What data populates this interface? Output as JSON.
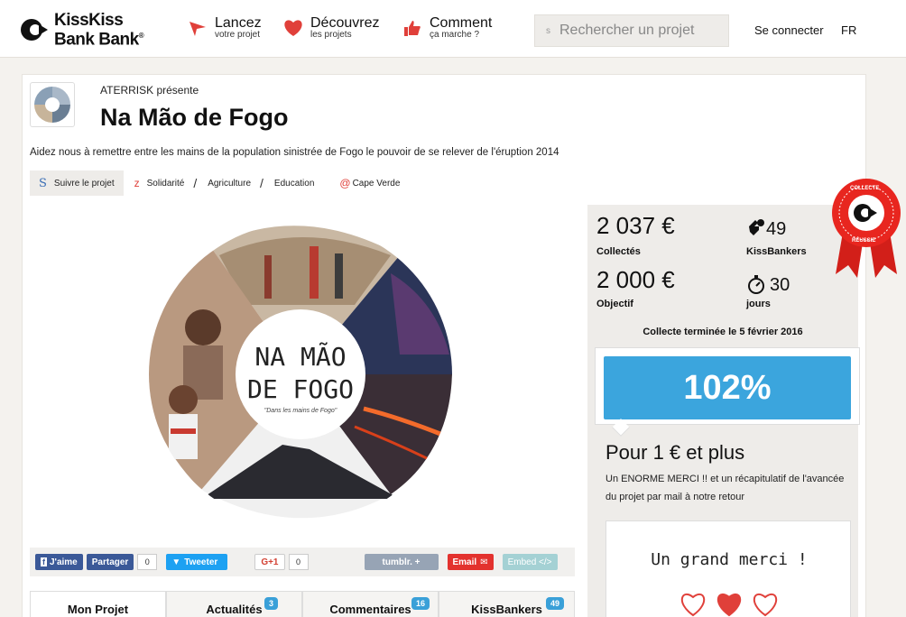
{
  "header": {
    "logo_text_line1": "KissKiss",
    "logo_text_line2": "Bank Bank",
    "logo_reg": "®",
    "nav": [
      {
        "main": "Lancez",
        "sub": "votre projet",
        "icon": "paper-plane-icon",
        "color": "#e0403a"
      },
      {
        "main": "Découvrez",
        "sub": "les projets",
        "icon": "heart-icon",
        "color": "#e0403a"
      },
      {
        "main": "Comment",
        "sub": "ça marche ?",
        "icon": "thumbs-up-icon",
        "color": "#e0403a"
      }
    ],
    "search_glyph": "s",
    "search_placeholder": "Rechercher un projet",
    "login": "Se connecter",
    "lang": "FR"
  },
  "project": {
    "presenter": "ATERRISK présente",
    "title": "Na Mão de Fogo",
    "description": "Aidez nous à remettre entre les mains de la population sinistrée de Fogo le pouvoir de se relever de l'éruption 2014",
    "follow_label": "Suivre le projet",
    "follow_glyph": "S",
    "tag_glyph": "z",
    "tags": [
      "Solidarité",
      "Agriculture",
      "Education"
    ],
    "location": "Cape Verde",
    "visual_title_line1": "NA MÃO",
    "visual_title_line2": "DE FOGO",
    "visual_subtitle": "\"Dans les mains de Fogo\""
  },
  "share": {
    "like": "J'aime",
    "partager": "Partager",
    "fb_count": "0",
    "tweet": "Tweeter",
    "gplus": "G+1",
    "gplus_count": "0",
    "tumblr": "tumblr. +",
    "email": "Email",
    "embed": "Embed </>"
  },
  "tabs": [
    {
      "label": "Mon Projet",
      "badge": ""
    },
    {
      "label": "Actualités",
      "badge": "3"
    },
    {
      "label": "Commentaires",
      "badge": "16"
    },
    {
      "label": "KissBankers",
      "badge": "49"
    }
  ],
  "stats": {
    "collected": "2 037 €",
    "collected_label": "Collectés",
    "backers": "49",
    "backers_label": "KissBankers",
    "goal": "2 000 €",
    "goal_label": "Objectif",
    "days": "30",
    "days_label": "jours",
    "ended": "Collecte terminée le 5 février 2016",
    "percent": "102%",
    "progress_fraction": 1.02
  },
  "reward": {
    "title": "Pour 1 € et plus",
    "desc": "Un ENORME MERCI !! et un récapitulatif de l'avancée du projet par mail à notre retour",
    "image_text": "Un grand merci !"
  },
  "ribbon": {
    "top": "COLLECTE",
    "bottom": "RÉUSSIE",
    "color": "#e8261f"
  }
}
